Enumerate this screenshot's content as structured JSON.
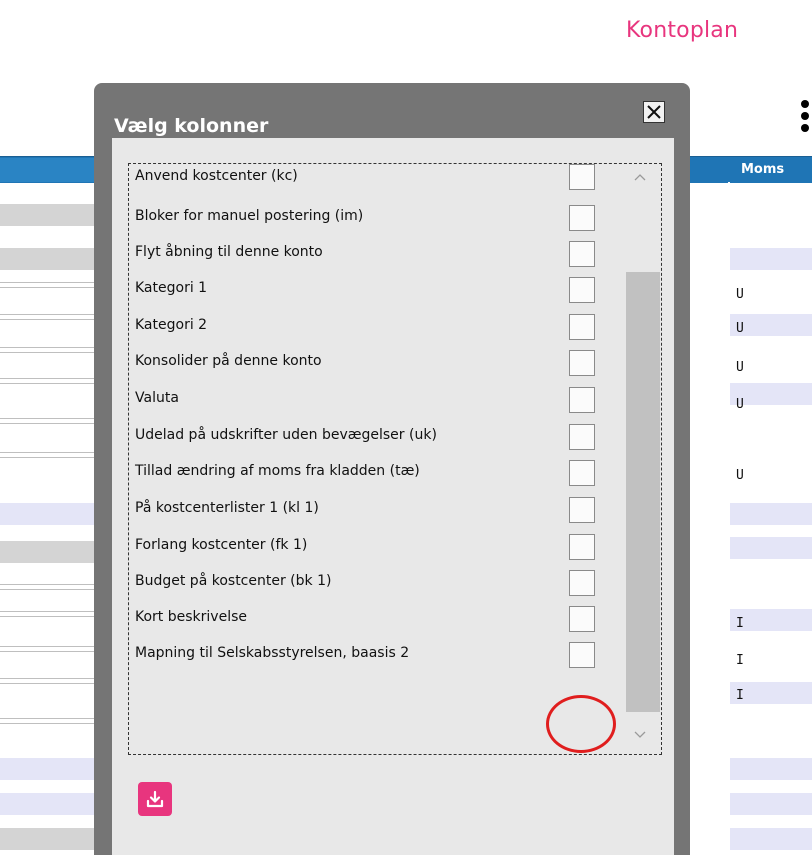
{
  "page": {
    "title": "Kontoplan"
  },
  "table": {
    "column_header": "Moms",
    "moms_values": [
      "U",
      "U",
      "U",
      "U",
      "U",
      "I",
      "I",
      "I"
    ]
  },
  "dialog": {
    "title": "Vælg kolonner",
    "columns": [
      {
        "label": "Anvend kostcenter (kc)",
        "checked": false
      },
      {
        "label": "Bloker for manuel postering (im)",
        "checked": false
      },
      {
        "label": "Flyt åbning til denne konto",
        "checked": false
      },
      {
        "label": "Kategori 1",
        "checked": false
      },
      {
        "label": "Kategori 2",
        "checked": false
      },
      {
        "label": "Konsolider på denne konto",
        "checked": false
      },
      {
        "label": "Valuta",
        "checked": false
      },
      {
        "label": "Udelad på udskrifter uden bevægelser (uk)",
        "checked": false
      },
      {
        "label": "Tillad ændring af moms fra kladden (tæ)",
        "checked": false
      },
      {
        "label": "På kostcenterlister 1 (kl 1)",
        "checked": false
      },
      {
        "label": "Forlang kostcenter (fk 1)",
        "checked": false
      },
      {
        "label": "Budget på kostcenter (bk 1)",
        "checked": false
      },
      {
        "label": "Kort beskrivelse",
        "checked": false
      },
      {
        "label": "Mapning til Selskabsstyrelsen, baasis 2",
        "checked": false
      }
    ]
  },
  "colors": {
    "accent": "#e8357e",
    "header_blue": "#1f75b5",
    "highlight": "#e01e1e"
  },
  "icons": {
    "close": "close-icon",
    "download": "download-icon",
    "more": "more-vertical-icon"
  }
}
